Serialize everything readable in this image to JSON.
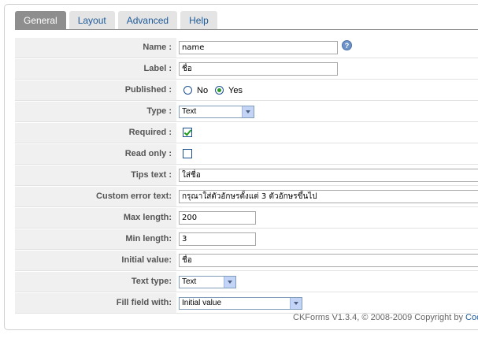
{
  "tabs": [
    "General",
    "Layout",
    "Advanced",
    "Help"
  ],
  "fields": {
    "name": {
      "label": "Name :",
      "value": "name"
    },
    "field_label": {
      "label": "Label :",
      "value": "ชื่อ"
    },
    "published": {
      "label": "Published :",
      "no": "No",
      "yes": "Yes",
      "selected": "Yes"
    },
    "type": {
      "label": "Type :",
      "value": "Text"
    },
    "required": {
      "label": "Required :",
      "checked": true
    },
    "readonly": {
      "label": "Read only :",
      "checked": false
    },
    "tips": {
      "label": "Tips text :",
      "value": "ใส่ชื่อ"
    },
    "custom_error": {
      "label": "Custom error text:",
      "value": "กรุณาใส่ตัวอักษรตั้งแต่ 3 ตัวอักษรขึ้นไป"
    },
    "max_length": {
      "label": "Max length:",
      "value": "200"
    },
    "min_length": {
      "label": "Min length:",
      "value": "3"
    },
    "initial_value": {
      "label": "Initial value:",
      "value": "ชื่อ"
    },
    "text_type": {
      "label": "Text type:",
      "value": "Text"
    },
    "fill_field": {
      "label": "Fill field with:",
      "value": "Initial value"
    }
  },
  "footer": {
    "text": "CKForms V1.3.4, © 2008-2009 Copyright by ",
    "link": "Cool"
  },
  "help_icon_glyph": "?",
  "colors": {
    "tab_active": "#8e8e8e",
    "tab_text": "#1c5a9a",
    "check": "#1f9a1f"
  }
}
